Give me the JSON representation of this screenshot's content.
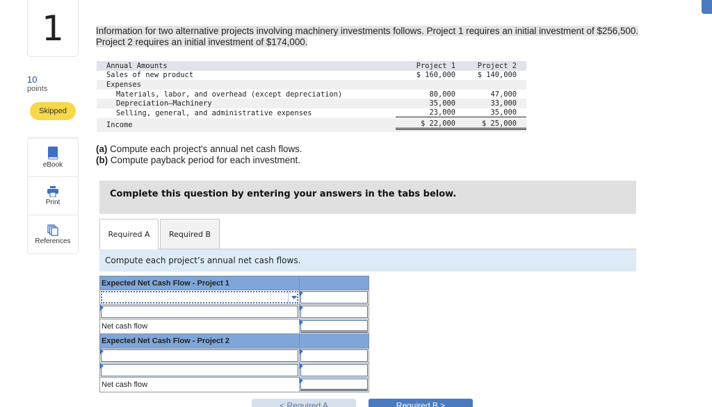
{
  "question": {
    "number": "1",
    "points_value": "10",
    "points_label": "points",
    "status": "Skipped"
  },
  "tools": [
    {
      "label": "eBook",
      "icon": "book-icon"
    },
    {
      "label": "Print",
      "icon": "printer-icon"
    },
    {
      "label": "References",
      "icon": "references-icon"
    }
  ],
  "intro": {
    "line1": "Information for two alternative projects involving machinery investments follows. Project 1 requires an initial investment of $256,500.",
    "line2": "Project 2 requires an initial investment of $174,000."
  },
  "annual_table": {
    "header": {
      "label": "Annual Amounts",
      "col1": "Project 1",
      "col2": "Project 2"
    },
    "rows": [
      {
        "label": "Sales of new product",
        "col1": "$ 160,000",
        "col2": "$ 140,000"
      },
      {
        "label": "Expenses",
        "col1": "",
        "col2": ""
      },
      {
        "label": "Materials, labor, and overhead (except depreciation)",
        "col1": "80,000",
        "col2": "47,000"
      },
      {
        "label": "Depreciation—Machinery",
        "col1": "35,000",
        "col2": "33,000"
      },
      {
        "label": "Selling, general, and administrative expenses",
        "col1": "23,000",
        "col2": "35,000"
      }
    ],
    "income": {
      "label": "Income",
      "col1": "$ 22,000",
      "col2": "$ 25,000"
    }
  },
  "parts": {
    "a_tag": "(a)",
    "a_text": " Compute each project's annual net cash flows.",
    "b_tag": "(b)",
    "b_text": " Compute payback period for each investment."
  },
  "complete_prompt": "Complete this question by entering your answers in the tabs below.",
  "tabs": [
    {
      "label": "Required A",
      "active": true
    },
    {
      "label": "Required B",
      "active": false
    }
  ],
  "instruction": "Compute each project’s annual net cash flows.",
  "answer_grid": {
    "project1_header": "Expected Net Cash Flow - Project 1",
    "project2_header": "Expected Net Cash Flow - Project 2",
    "net_cash_flow_label": "Net cash flow",
    "project1_rows": [
      {
        "label_value": "",
        "amount_value": ""
      },
      {
        "label_value": "",
        "amount_value": ""
      }
    ],
    "project1_total": "",
    "project2_rows": [
      {
        "label_value": "",
        "amount_value": ""
      },
      {
        "label_value": "",
        "amount_value": ""
      }
    ],
    "project2_total": ""
  },
  "nav": {
    "prev_label": "< Required A",
    "next_label": "Required B >"
  },
  "colors": {
    "accent": "#4a7bc0",
    "skipped_badge": "#f7d84a",
    "grid_header": "#7fa6d9",
    "instruction_bg": "#dcebf7"
  }
}
